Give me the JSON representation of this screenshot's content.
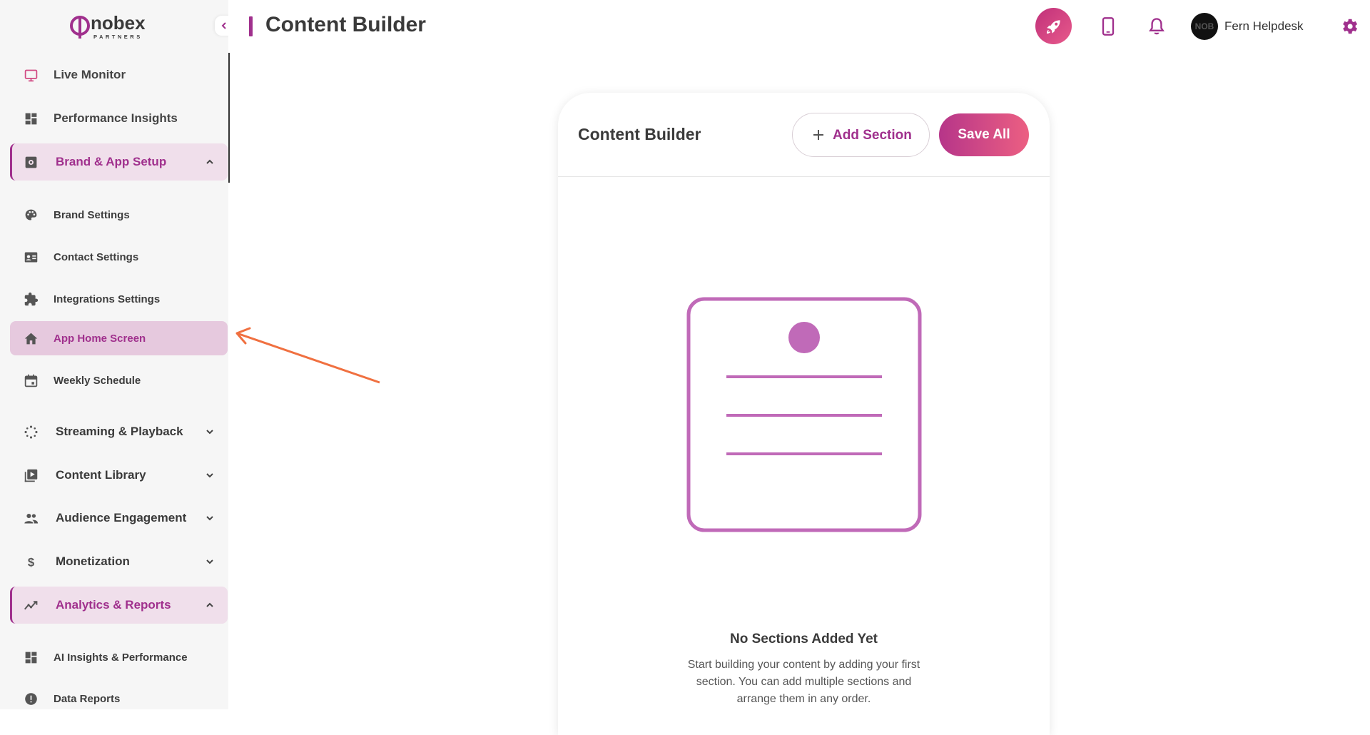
{
  "brand": {
    "logo_text": "nobex",
    "logo_subtext": "PARTNERS",
    "accent": "#a0308d",
    "accent_light": "#f0dfeb",
    "active_bg": "#e6c9de"
  },
  "header": {
    "title": "Content Builder",
    "user_name": "Fern Helpdesk",
    "icons": [
      "rocket-icon",
      "mobile-icon",
      "bell-icon",
      "gear-icon"
    ]
  },
  "sidebar": {
    "items": [
      {
        "label": "Live Monitor",
        "icon": "monitor-icon"
      },
      {
        "label": "Performance Insights",
        "icon": "dashboard-icon"
      },
      {
        "label": "Brand & App Setup",
        "icon": "settings-box-icon",
        "expanded": true
      },
      {
        "label": "Brand Settings",
        "icon": "palette-icon"
      },
      {
        "label": "Contact Settings",
        "icon": "contact-card-icon"
      },
      {
        "label": "Integrations Settings",
        "icon": "puzzle-icon"
      },
      {
        "label": "App Home Screen",
        "icon": "home-icon",
        "active": true
      },
      {
        "label": "Weekly Schedule",
        "icon": "calendar-icon"
      },
      {
        "label": "Streaming & Playback",
        "icon": "spinner-icon"
      },
      {
        "label": "Content Library",
        "icon": "library-icon"
      },
      {
        "label": "Audience Engagement",
        "icon": "people-icon"
      },
      {
        "label": "Monetization",
        "icon": "dollar-icon"
      },
      {
        "label": "Analytics & Reports",
        "icon": "trend-icon",
        "expanded": true
      },
      {
        "label": "AI Insights & Performance",
        "icon": "dashboard-icon"
      },
      {
        "label": "Data Reports",
        "icon": "info-icon"
      }
    ]
  },
  "builder": {
    "title": "Content Builder",
    "add_section_label": "Add Section",
    "save_all_label": "Save All",
    "empty_title": "No Sections Added Yet",
    "empty_description": "Start building your content by adding your first section. You can add multiple sections and arrange them in any order."
  }
}
